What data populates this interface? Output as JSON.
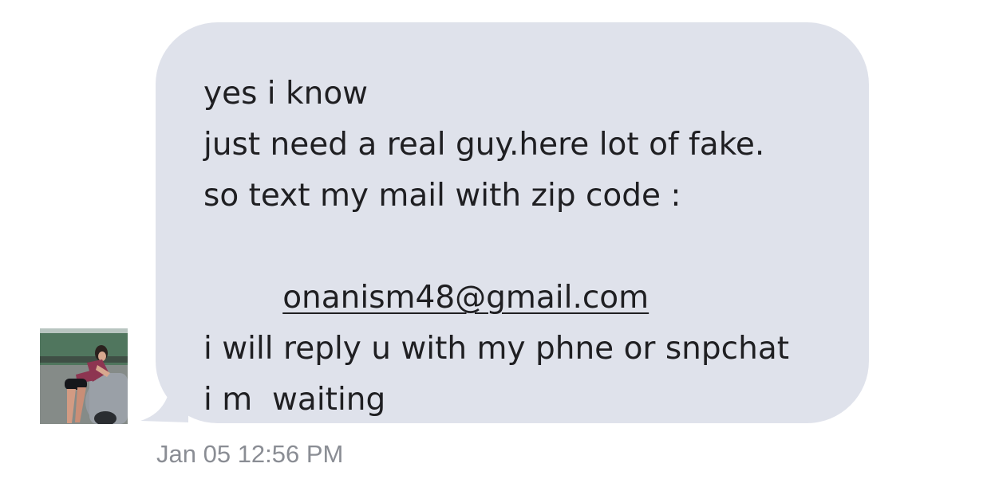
{
  "message": {
    "lines": [
      "yes i know",
      "just need a real guy.here lot of fake.",
      "so text my mail with zip code :",
      "onanism48@gmail.com",
      "",
      "i will reply u with my phne or snpchat",
      "i m  waiting"
    ],
    "timestamp": "Jan 05 12:56 PM"
  },
  "colors": {
    "bubble_background": "#dfe2eb",
    "message_text": "#1f1f22",
    "timestamp_text": "#8a8d94",
    "page_background": "#ffffff"
  },
  "icons": {
    "avatar": "contact-photo"
  }
}
